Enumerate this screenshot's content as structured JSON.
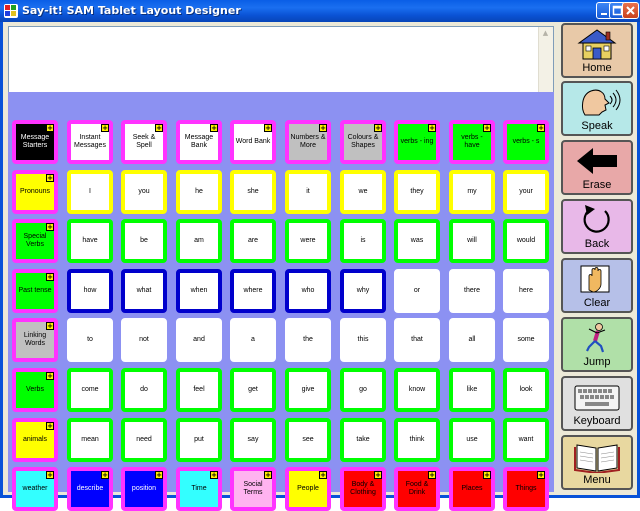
{
  "window": {
    "title": "Say-it! SAM Tablet Layout Designer"
  },
  "message": {
    "text": ""
  },
  "board": {
    "rows": [
      [
        {
          "label": "Message Starters",
          "bg": "#000000",
          "fg": "#ffffff",
          "border": "#ff33ff",
          "folder": true
        },
        {
          "label": "Instant Messages",
          "bg": "#ffffff",
          "fg": "#000000",
          "border": "#ff33ff",
          "folder": true
        },
        {
          "label": "Seek & Spell",
          "bg": "#ffffff",
          "fg": "#000000",
          "border": "#ff33ff",
          "folder": true
        },
        {
          "label": "Message Bank",
          "bg": "#ffffff",
          "fg": "#000000",
          "border": "#ff33ff",
          "folder": true
        },
        {
          "label": "Word Bank",
          "bg": "#ffffff",
          "fg": "#000000",
          "border": "#ff33ff",
          "folder": true
        },
        {
          "label": "Numbers & More",
          "bg": "#c0c0c0",
          "fg": "#000000",
          "border": "#ff33ff",
          "folder": true
        },
        {
          "label": "Colours & Shapes",
          "bg": "#c0c0c0",
          "fg": "#000000",
          "border": "#ff33ff",
          "folder": true
        },
        {
          "label": "verbs - ing",
          "bg": "#00ff00",
          "fg": "#000000",
          "border": "#ff33ff",
          "folder": true
        },
        {
          "label": "verbs - have",
          "bg": "#00ff00",
          "fg": "#000000",
          "border": "#ff33ff",
          "folder": true
        },
        {
          "label": "verbs - s",
          "bg": "#00ff00",
          "fg": "#000000",
          "border": "#ff33ff",
          "folder": true
        }
      ],
      [
        {
          "label": "Pronouns",
          "bg": "#ffff00",
          "fg": "#000000",
          "border": "#ff33ff",
          "folder": true
        },
        {
          "label": "I",
          "bg": "#ffffff",
          "fg": "#000000",
          "border": "#ffff00",
          "folder": false
        },
        {
          "label": "you",
          "bg": "#ffffff",
          "fg": "#000000",
          "border": "#ffff00",
          "folder": false
        },
        {
          "label": "he",
          "bg": "#ffffff",
          "fg": "#000000",
          "border": "#ffff00",
          "folder": false
        },
        {
          "label": "she",
          "bg": "#ffffff",
          "fg": "#000000",
          "border": "#ffff00",
          "folder": false
        },
        {
          "label": "it",
          "bg": "#ffffff",
          "fg": "#000000",
          "border": "#ffff00",
          "folder": false
        },
        {
          "label": "we",
          "bg": "#ffffff",
          "fg": "#000000",
          "border": "#ffff00",
          "folder": false
        },
        {
          "label": "they",
          "bg": "#ffffff",
          "fg": "#000000",
          "border": "#ffff00",
          "folder": false
        },
        {
          "label": "my",
          "bg": "#ffffff",
          "fg": "#000000",
          "border": "#ffff00",
          "folder": false
        },
        {
          "label": "your",
          "bg": "#ffffff",
          "fg": "#000000",
          "border": "#ffff00",
          "folder": false
        }
      ],
      [
        {
          "label": "Special Verbs",
          "bg": "#00ff00",
          "fg": "#000000",
          "border": "#ff33ff",
          "folder": true
        },
        {
          "label": "have",
          "bg": "#ffffff",
          "fg": "#000000",
          "border": "#00ff00",
          "folder": false
        },
        {
          "label": "be",
          "bg": "#ffffff",
          "fg": "#000000",
          "border": "#00ff00",
          "folder": false
        },
        {
          "label": "am",
          "bg": "#ffffff",
          "fg": "#000000",
          "border": "#00ff00",
          "folder": false
        },
        {
          "label": "are",
          "bg": "#ffffff",
          "fg": "#000000",
          "border": "#00ff00",
          "folder": false
        },
        {
          "label": "were",
          "bg": "#ffffff",
          "fg": "#000000",
          "border": "#00ff00",
          "folder": false
        },
        {
          "label": "is",
          "bg": "#ffffff",
          "fg": "#000000",
          "border": "#00ff00",
          "folder": false
        },
        {
          "label": "was",
          "bg": "#ffffff",
          "fg": "#000000",
          "border": "#00ff00",
          "folder": false
        },
        {
          "label": "will",
          "bg": "#ffffff",
          "fg": "#000000",
          "border": "#00ff00",
          "folder": false
        },
        {
          "label": "would",
          "bg": "#ffffff",
          "fg": "#000000",
          "border": "#00ff00",
          "folder": false
        }
      ],
      [
        {
          "label": "Past tense",
          "bg": "#00ff00",
          "fg": "#000000",
          "border": "#ff33ff",
          "folder": true
        },
        {
          "label": "how",
          "bg": "#ffffff",
          "fg": "#000000",
          "border": "#0000cc",
          "folder": false
        },
        {
          "label": "what",
          "bg": "#ffffff",
          "fg": "#000000",
          "border": "#0000cc",
          "folder": false
        },
        {
          "label": "when",
          "bg": "#ffffff",
          "fg": "#000000",
          "border": "#0000cc",
          "folder": false
        },
        {
          "label": "where",
          "bg": "#ffffff",
          "fg": "#000000",
          "border": "#0000cc",
          "folder": false
        },
        {
          "label": "who",
          "bg": "#ffffff",
          "fg": "#000000",
          "border": "#0000cc",
          "folder": false
        },
        {
          "label": "why",
          "bg": "#ffffff",
          "fg": "#000000",
          "border": "#0000cc",
          "folder": false
        },
        {
          "label": "or",
          "bg": "#ffffff",
          "fg": "#000000",
          "border": "#ffffff",
          "folder": false
        },
        {
          "label": "there",
          "bg": "#ffffff",
          "fg": "#000000",
          "border": "#ffffff",
          "folder": false
        },
        {
          "label": "here",
          "bg": "#ffffff",
          "fg": "#000000",
          "border": "#ffffff",
          "folder": false
        }
      ],
      [
        {
          "label": "Linking Words",
          "bg": "#c0c0c0",
          "fg": "#000000",
          "border": "#ff33ff",
          "folder": true
        },
        {
          "label": "to",
          "bg": "#ffffff",
          "fg": "#000000",
          "border": "#ffffff",
          "folder": false
        },
        {
          "label": "not",
          "bg": "#ffffff",
          "fg": "#000000",
          "border": "#ffffff",
          "folder": false
        },
        {
          "label": "and",
          "bg": "#ffffff",
          "fg": "#000000",
          "border": "#ffffff",
          "folder": false
        },
        {
          "label": "a",
          "bg": "#ffffff",
          "fg": "#000000",
          "border": "#ffffff",
          "folder": false
        },
        {
          "label": "the",
          "bg": "#ffffff",
          "fg": "#000000",
          "border": "#ffffff",
          "folder": false
        },
        {
          "label": "this",
          "bg": "#ffffff",
          "fg": "#000000",
          "border": "#ffffff",
          "folder": false
        },
        {
          "label": "that",
          "bg": "#ffffff",
          "fg": "#000000",
          "border": "#ffffff",
          "folder": false
        },
        {
          "label": "all",
          "bg": "#ffffff",
          "fg": "#000000",
          "border": "#ffffff",
          "folder": false
        },
        {
          "label": "some",
          "bg": "#ffffff",
          "fg": "#000000",
          "border": "#ffffff",
          "folder": false
        }
      ],
      [
        {
          "label": "Verbs",
          "bg": "#00ff00",
          "fg": "#000000",
          "border": "#ff33ff",
          "folder": true
        },
        {
          "label": "come",
          "bg": "#ffffff",
          "fg": "#000000",
          "border": "#00ff00",
          "folder": false
        },
        {
          "label": "do",
          "bg": "#ffffff",
          "fg": "#000000",
          "border": "#00ff00",
          "folder": false
        },
        {
          "label": "feel",
          "bg": "#ffffff",
          "fg": "#000000",
          "border": "#00ff00",
          "folder": false
        },
        {
          "label": "get",
          "bg": "#ffffff",
          "fg": "#000000",
          "border": "#00ff00",
          "folder": false
        },
        {
          "label": "give",
          "bg": "#ffffff",
          "fg": "#000000",
          "border": "#00ff00",
          "folder": false
        },
        {
          "label": "go",
          "bg": "#ffffff",
          "fg": "#000000",
          "border": "#00ff00",
          "folder": false
        },
        {
          "label": "know",
          "bg": "#ffffff",
          "fg": "#000000",
          "border": "#00ff00",
          "folder": false
        },
        {
          "label": "like",
          "bg": "#ffffff",
          "fg": "#000000",
          "border": "#00ff00",
          "folder": false
        },
        {
          "label": "look",
          "bg": "#ffffff",
          "fg": "#000000",
          "border": "#00ff00",
          "folder": false
        }
      ],
      [
        {
          "label": "animals",
          "bg": "#ffff00",
          "fg": "#000000",
          "border": "#ff33ff",
          "folder": true
        },
        {
          "label": "mean",
          "bg": "#ffffff",
          "fg": "#000000",
          "border": "#00ff00",
          "folder": false
        },
        {
          "label": "need",
          "bg": "#ffffff",
          "fg": "#000000",
          "border": "#00ff00",
          "folder": false
        },
        {
          "label": "put",
          "bg": "#ffffff",
          "fg": "#000000",
          "border": "#00ff00",
          "folder": false
        },
        {
          "label": "say",
          "bg": "#ffffff",
          "fg": "#000000",
          "border": "#00ff00",
          "folder": false
        },
        {
          "label": "see",
          "bg": "#ffffff",
          "fg": "#000000",
          "border": "#00ff00",
          "folder": false
        },
        {
          "label": "take",
          "bg": "#ffffff",
          "fg": "#000000",
          "border": "#00ff00",
          "folder": false
        },
        {
          "label": "think",
          "bg": "#ffffff",
          "fg": "#000000",
          "border": "#00ff00",
          "folder": false
        },
        {
          "label": "use",
          "bg": "#ffffff",
          "fg": "#000000",
          "border": "#00ff00",
          "folder": false
        },
        {
          "label": "want",
          "bg": "#ffffff",
          "fg": "#000000",
          "border": "#00ff00",
          "folder": false
        }
      ],
      [
        {
          "label": "weather",
          "bg": "#33ffff",
          "fg": "#000000",
          "border": "#ff33ff",
          "folder": true
        },
        {
          "label": "describe",
          "bg": "#0000ff",
          "fg": "#ffffff",
          "border": "#ff33ff",
          "folder": true
        },
        {
          "label": "position",
          "bg": "#0000ff",
          "fg": "#ffffff",
          "border": "#ff33ff",
          "folder": true
        },
        {
          "label": "Time",
          "bg": "#33ffff",
          "fg": "#000000",
          "border": "#ff33ff",
          "folder": true
        },
        {
          "label": "Social Terms",
          "bg": "#ffb3f0",
          "fg": "#000000",
          "border": "#ff33ff",
          "folder": true
        },
        {
          "label": "People",
          "bg": "#ffff00",
          "fg": "#000000",
          "border": "#ff33ff",
          "folder": true
        },
        {
          "label": "Body & Clothing",
          "bg": "#ff0000",
          "fg": "#000000",
          "border": "#ff33ff",
          "folder": true
        },
        {
          "label": "Food & Drink",
          "bg": "#ff0000",
          "fg": "#000000",
          "border": "#ff33ff",
          "folder": true
        },
        {
          "label": "Places",
          "bg": "#ff0000",
          "fg": "#000000",
          "border": "#ff33ff",
          "folder": true
        },
        {
          "label": "Things",
          "bg": "#ff0000",
          "fg": "#000000",
          "border": "#ff33ff",
          "folder": true
        }
      ]
    ]
  },
  "sidebar": {
    "buttons": [
      {
        "label": "Home",
        "icon": "house-icon",
        "bg": "#e8c9a8"
      },
      {
        "label": "Speak",
        "icon": "speaking-head-icon",
        "bg": "#b6e8e8"
      },
      {
        "label": "Erase",
        "icon": "left-arrow-icon",
        "bg": "#e8a8a8"
      },
      {
        "label": "Back",
        "icon": "back-arrow-icon",
        "bg": "#e8b8e8"
      },
      {
        "label": "Clear",
        "icon": "wiping-hand-icon",
        "bg": "#b6c0e8"
      },
      {
        "label": "Jump",
        "icon": "jumping-person-icon",
        "bg": "#b0e0a8"
      },
      {
        "label": "Keyboard",
        "icon": "keyboard-icon",
        "bg": "#e0e0e0"
      },
      {
        "label": "Menu",
        "icon": "open-book-icon",
        "bg": "#e8d8a0"
      }
    ]
  }
}
